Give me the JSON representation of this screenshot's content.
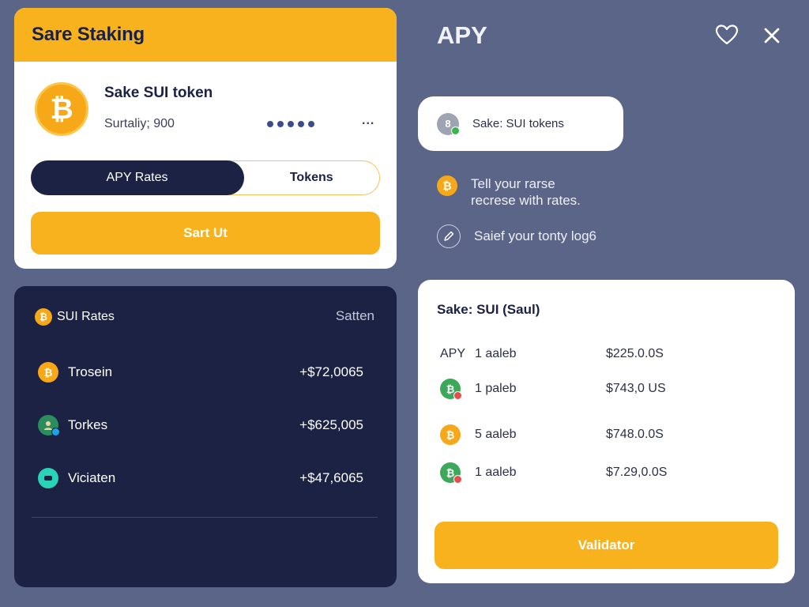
{
  "staking": {
    "title": "Sare Staking",
    "coin_symbol": "₿",
    "token_name": "Sake SUI token",
    "token_sub": "Surtaliy; 900",
    "more_label": "...",
    "tabs": [
      {
        "label": "APY Rates",
        "active": true
      },
      {
        "label": "Tokens",
        "active": false
      }
    ],
    "start_label": "Sart Ut"
  },
  "apy": {
    "title": "APY",
    "pill_label": "Sake: SUI tokens",
    "pill_avatar": "8",
    "info_line1a": "Tell your rarse",
    "info_line1b": "recrese with rates.",
    "info_line2": "Saief your tonty log6",
    "icons": [
      "heart-icon",
      "close-icon",
      "pen-icon"
    ]
  },
  "rates": {
    "title": "SUI Rates",
    "action": "Satten",
    "rows": [
      {
        "name": "Trosein",
        "value": "+$72,0065",
        "icon": "coin"
      },
      {
        "name": "Torkes",
        "value": "+$625,005",
        "icon": "face"
      },
      {
        "name": "Viciaten",
        "value": "+$47,6065",
        "icon": "teal"
      }
    ]
  },
  "validators": {
    "title": "Sake: SUI (Saul)",
    "apy_label": "APY",
    "rows": [
      {
        "label": "1 aaleb",
        "amount": "$225.0.0S",
        "icon": "none"
      },
      {
        "label": "1 paleb",
        "amount": "$743,0 US",
        "icon": "green"
      },
      {
        "label": "5 aaleb",
        "amount": "$748.0.0S",
        "icon": "gold"
      },
      {
        "label": "1 aaleb",
        "amount": "$7.29,0.0S",
        "icon": "green"
      }
    ],
    "button_label": "Validator"
  },
  "colors": {
    "background": "#5b6588",
    "accent": "#f8b21e",
    "navy": "#1c2244"
  }
}
